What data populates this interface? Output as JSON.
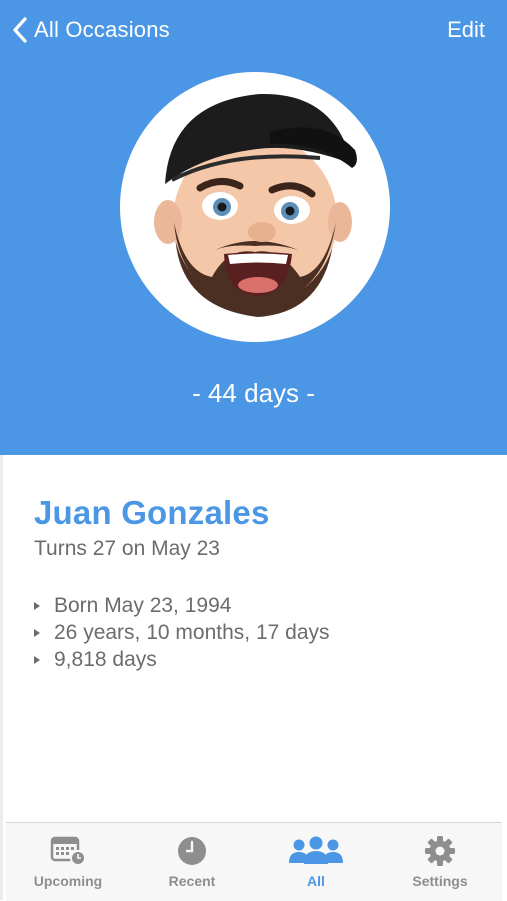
{
  "nav": {
    "back_label": "All Occasions",
    "edit_label": "Edit"
  },
  "hero": {
    "countdown": "- 44 days -",
    "background_color": "#4b97e6",
    "avatar_icon": "memoji-avatar-icon"
  },
  "person": {
    "name": "Juan Gonzales",
    "turns": "Turns 27 on May 23",
    "facts": [
      "Born May 23, 1994",
      "26 years, 10 months, 17 days",
      "9,818 days"
    ]
  },
  "tabbar": {
    "tabs": [
      {
        "label": "Upcoming",
        "icon": "calendar-icon",
        "active": false
      },
      {
        "label": "Recent",
        "icon": "clock-icon",
        "active": false
      },
      {
        "label": "All",
        "icon": "people-icon",
        "active": true
      },
      {
        "label": "Settings",
        "icon": "gear-icon",
        "active": false
      }
    ]
  },
  "colors": {
    "accent": "#4b97e6",
    "text_secondary": "#6c6c6c",
    "tab_inactive": "#8e8e8e"
  }
}
